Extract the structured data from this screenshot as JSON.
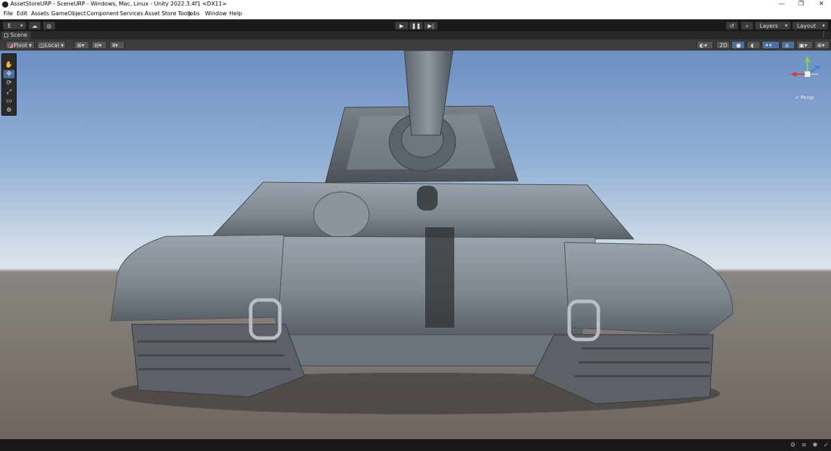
{
  "window": {
    "title": "AssetStoreURP - SceneURP - Windows, Mac, Linux - Unity 2022.3.4f1 <DX11>",
    "controls": {
      "minimize": "—",
      "restore": "❐",
      "close": "✕"
    }
  },
  "menu": {
    "items": [
      "File",
      "Edit",
      "Assets",
      "GameObject",
      "Component",
      "Services",
      "Asset Store Tools",
      "Jobs",
      "Window",
      "Help"
    ]
  },
  "toolbar": {
    "account_label": "E",
    "layers_label": "Layers",
    "layout_label": "Layout",
    "play_icon": "play-icon",
    "pause_icon": "pause-icon",
    "step_icon": "step-icon"
  },
  "scene_tab": {
    "label": "Scene"
  },
  "scene_toolbar": {
    "pivot_label": "Pivot",
    "local_label": "Local",
    "mode_2d_label": "2D"
  },
  "gizmo": {
    "view_label": "< Persp"
  },
  "colors": {
    "editor_bg": "#191919",
    "panel": "#3c3c3c",
    "accent_active": "#4d6f9e",
    "gizmo_x": "#e33b3b",
    "gizmo_y": "#8bd14a",
    "gizmo_z": "#3b7be3"
  }
}
